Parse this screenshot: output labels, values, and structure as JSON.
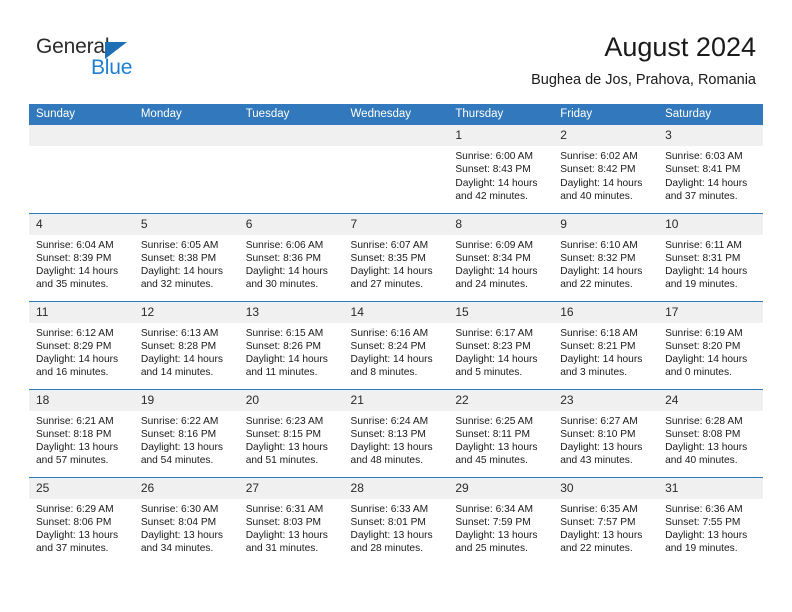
{
  "brand": {
    "name_part1": "General",
    "name_part2": "Blue",
    "triangle_color": "#1f6fb5",
    "blue_text_color": "#1f7fd0"
  },
  "header": {
    "title": "August 2024",
    "subtitle": "Bughea de Jos, Prahova, Romania",
    "accent_color": "#3278bc",
    "daynum_band_color": "#f0f0f0"
  },
  "columns": [
    "Sunday",
    "Monday",
    "Tuesday",
    "Wednesday",
    "Thursday",
    "Friday",
    "Saturday"
  ],
  "weeks": [
    [
      {
        "day": "",
        "sunrise": "",
        "sunset": "",
        "daylight_line1": "",
        "daylight_line2": ""
      },
      {
        "day": "",
        "sunrise": "",
        "sunset": "",
        "daylight_line1": "",
        "daylight_line2": ""
      },
      {
        "day": "",
        "sunrise": "",
        "sunset": "",
        "daylight_line1": "",
        "daylight_line2": ""
      },
      {
        "day": "",
        "sunrise": "",
        "sunset": "",
        "daylight_line1": "",
        "daylight_line2": ""
      },
      {
        "day": "1",
        "sunrise": "Sunrise: 6:00 AM",
        "sunset": "Sunset: 8:43 PM",
        "daylight_line1": "Daylight: 14 hours",
        "daylight_line2": "and 42 minutes."
      },
      {
        "day": "2",
        "sunrise": "Sunrise: 6:02 AM",
        "sunset": "Sunset: 8:42 PM",
        "daylight_line1": "Daylight: 14 hours",
        "daylight_line2": "and 40 minutes."
      },
      {
        "day": "3",
        "sunrise": "Sunrise: 6:03 AM",
        "sunset": "Sunset: 8:41 PM",
        "daylight_line1": "Daylight: 14 hours",
        "daylight_line2": "and 37 minutes."
      }
    ],
    [
      {
        "day": "4",
        "sunrise": "Sunrise: 6:04 AM",
        "sunset": "Sunset: 8:39 PM",
        "daylight_line1": "Daylight: 14 hours",
        "daylight_line2": "and 35 minutes."
      },
      {
        "day": "5",
        "sunrise": "Sunrise: 6:05 AM",
        "sunset": "Sunset: 8:38 PM",
        "daylight_line1": "Daylight: 14 hours",
        "daylight_line2": "and 32 minutes."
      },
      {
        "day": "6",
        "sunrise": "Sunrise: 6:06 AM",
        "sunset": "Sunset: 8:36 PM",
        "daylight_line1": "Daylight: 14 hours",
        "daylight_line2": "and 30 minutes."
      },
      {
        "day": "7",
        "sunrise": "Sunrise: 6:07 AM",
        "sunset": "Sunset: 8:35 PM",
        "daylight_line1": "Daylight: 14 hours",
        "daylight_line2": "and 27 minutes."
      },
      {
        "day": "8",
        "sunrise": "Sunrise: 6:09 AM",
        "sunset": "Sunset: 8:34 PM",
        "daylight_line1": "Daylight: 14 hours",
        "daylight_line2": "and 24 minutes."
      },
      {
        "day": "9",
        "sunrise": "Sunrise: 6:10 AM",
        "sunset": "Sunset: 8:32 PM",
        "daylight_line1": "Daylight: 14 hours",
        "daylight_line2": "and 22 minutes."
      },
      {
        "day": "10",
        "sunrise": "Sunrise: 6:11 AM",
        "sunset": "Sunset: 8:31 PM",
        "daylight_line1": "Daylight: 14 hours",
        "daylight_line2": "and 19 minutes."
      }
    ],
    [
      {
        "day": "11",
        "sunrise": "Sunrise: 6:12 AM",
        "sunset": "Sunset: 8:29 PM",
        "daylight_line1": "Daylight: 14 hours",
        "daylight_line2": "and 16 minutes."
      },
      {
        "day": "12",
        "sunrise": "Sunrise: 6:13 AM",
        "sunset": "Sunset: 8:28 PM",
        "daylight_line1": "Daylight: 14 hours",
        "daylight_line2": "and 14 minutes."
      },
      {
        "day": "13",
        "sunrise": "Sunrise: 6:15 AM",
        "sunset": "Sunset: 8:26 PM",
        "daylight_line1": "Daylight: 14 hours",
        "daylight_line2": "and 11 minutes."
      },
      {
        "day": "14",
        "sunrise": "Sunrise: 6:16 AM",
        "sunset": "Sunset: 8:24 PM",
        "daylight_line1": "Daylight: 14 hours",
        "daylight_line2": "and 8 minutes."
      },
      {
        "day": "15",
        "sunrise": "Sunrise: 6:17 AM",
        "sunset": "Sunset: 8:23 PM",
        "daylight_line1": "Daylight: 14 hours",
        "daylight_line2": "and 5 minutes."
      },
      {
        "day": "16",
        "sunrise": "Sunrise: 6:18 AM",
        "sunset": "Sunset: 8:21 PM",
        "daylight_line1": "Daylight: 14 hours",
        "daylight_line2": "and 3 minutes."
      },
      {
        "day": "17",
        "sunrise": "Sunrise: 6:19 AM",
        "sunset": "Sunset: 8:20 PM",
        "daylight_line1": "Daylight: 14 hours",
        "daylight_line2": "and 0 minutes."
      }
    ],
    [
      {
        "day": "18",
        "sunrise": "Sunrise: 6:21 AM",
        "sunset": "Sunset: 8:18 PM",
        "daylight_line1": "Daylight: 13 hours",
        "daylight_line2": "and 57 minutes."
      },
      {
        "day": "19",
        "sunrise": "Sunrise: 6:22 AM",
        "sunset": "Sunset: 8:16 PM",
        "daylight_line1": "Daylight: 13 hours",
        "daylight_line2": "and 54 minutes."
      },
      {
        "day": "20",
        "sunrise": "Sunrise: 6:23 AM",
        "sunset": "Sunset: 8:15 PM",
        "daylight_line1": "Daylight: 13 hours",
        "daylight_line2": "and 51 minutes."
      },
      {
        "day": "21",
        "sunrise": "Sunrise: 6:24 AM",
        "sunset": "Sunset: 8:13 PM",
        "daylight_line1": "Daylight: 13 hours",
        "daylight_line2": "and 48 minutes."
      },
      {
        "day": "22",
        "sunrise": "Sunrise: 6:25 AM",
        "sunset": "Sunset: 8:11 PM",
        "daylight_line1": "Daylight: 13 hours",
        "daylight_line2": "and 45 minutes."
      },
      {
        "day": "23",
        "sunrise": "Sunrise: 6:27 AM",
        "sunset": "Sunset: 8:10 PM",
        "daylight_line1": "Daylight: 13 hours",
        "daylight_line2": "and 43 minutes."
      },
      {
        "day": "24",
        "sunrise": "Sunrise: 6:28 AM",
        "sunset": "Sunset: 8:08 PM",
        "daylight_line1": "Daylight: 13 hours",
        "daylight_line2": "and 40 minutes."
      }
    ],
    [
      {
        "day": "25",
        "sunrise": "Sunrise: 6:29 AM",
        "sunset": "Sunset: 8:06 PM",
        "daylight_line1": "Daylight: 13 hours",
        "daylight_line2": "and 37 minutes."
      },
      {
        "day": "26",
        "sunrise": "Sunrise: 6:30 AM",
        "sunset": "Sunset: 8:04 PM",
        "daylight_line1": "Daylight: 13 hours",
        "daylight_line2": "and 34 minutes."
      },
      {
        "day": "27",
        "sunrise": "Sunrise: 6:31 AM",
        "sunset": "Sunset: 8:03 PM",
        "daylight_line1": "Daylight: 13 hours",
        "daylight_line2": "and 31 minutes."
      },
      {
        "day": "28",
        "sunrise": "Sunrise: 6:33 AM",
        "sunset": "Sunset: 8:01 PM",
        "daylight_line1": "Daylight: 13 hours",
        "daylight_line2": "and 28 minutes."
      },
      {
        "day": "29",
        "sunrise": "Sunrise: 6:34 AM",
        "sunset": "Sunset: 7:59 PM",
        "daylight_line1": "Daylight: 13 hours",
        "daylight_line2": "and 25 minutes."
      },
      {
        "day": "30",
        "sunrise": "Sunrise: 6:35 AM",
        "sunset": "Sunset: 7:57 PM",
        "daylight_line1": "Daylight: 13 hours",
        "daylight_line2": "and 22 minutes."
      },
      {
        "day": "31",
        "sunrise": "Sunrise: 6:36 AM",
        "sunset": "Sunset: 7:55 PM",
        "daylight_line1": "Daylight: 13 hours",
        "daylight_line2": "and 19 minutes."
      }
    ]
  ]
}
